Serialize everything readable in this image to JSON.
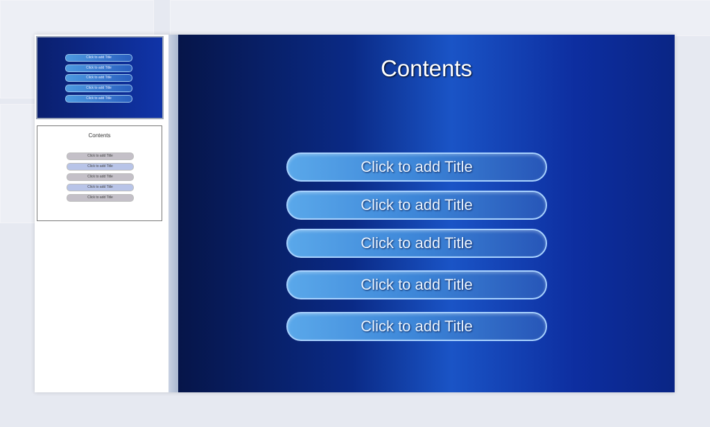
{
  "slide": {
    "title": "Contents",
    "items": [
      "Click to add Title",
      "Click to add Title",
      "Click to add Title",
      "Click to add Title",
      "Click to add Title"
    ]
  },
  "thumbnails": [
    {
      "items": [
        "Click to add Title",
        "Click to add Title",
        "Click to add Title",
        "Click to add Title",
        "Click to add Title"
      ]
    },
    {
      "title": "Contents",
      "items": [
        "Click to add Title",
        "Click to add Title",
        "Click to add Title",
        "Click to add Title",
        "Click to add Title"
      ],
      "item_colors": [
        "#c4c0c8",
        "#b8c4e8",
        "#c4c0c8",
        "#b8c4e8",
        "#c4c0c8"
      ]
    }
  ],
  "colors": {
    "slide_bg": "#0a2a86",
    "button": "#3d86d8"
  }
}
